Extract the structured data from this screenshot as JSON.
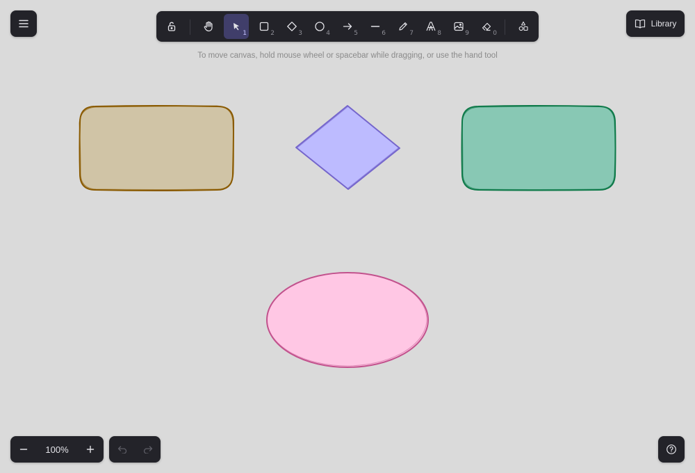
{
  "app": {
    "hint": "To move canvas, hold mouse wheel or spacebar while dragging, or use the hand tool",
    "library_label": "Library",
    "zoom_level": "100%"
  },
  "toolbar": {
    "tools": [
      {
        "name": "lock",
        "icon": "lock-icon",
        "key": ""
      },
      {
        "name": "hand",
        "icon": "hand-icon",
        "key": ""
      },
      {
        "name": "selection",
        "icon": "pointer-icon",
        "key": "1",
        "selected": true
      },
      {
        "name": "rectangle",
        "icon": "square-icon",
        "key": "2"
      },
      {
        "name": "diamond",
        "icon": "diamond-icon",
        "key": "3"
      },
      {
        "name": "ellipse",
        "icon": "circle-icon",
        "key": "4"
      },
      {
        "name": "arrow",
        "icon": "arrow-right-icon",
        "key": "5"
      },
      {
        "name": "line",
        "icon": "line-icon",
        "key": "6"
      },
      {
        "name": "draw",
        "icon": "pencil-icon",
        "key": "7"
      },
      {
        "name": "text",
        "icon": "text-icon",
        "key": "8"
      },
      {
        "name": "image",
        "icon": "image-icon",
        "key": "9"
      },
      {
        "name": "eraser",
        "icon": "eraser-icon",
        "key": "0"
      },
      {
        "name": "more-tools",
        "icon": "shapes-icon",
        "key": ""
      }
    ]
  },
  "shapes": [
    {
      "type": "rectangle",
      "fill": "#d0c4a6",
      "stroke": "#8a5a00"
    },
    {
      "type": "diamond",
      "fill": "#bdbbff",
      "stroke": "#7566cc"
    },
    {
      "type": "rectangle",
      "fill": "#88c8b4",
      "stroke": "#0f7a4a"
    },
    {
      "type": "ellipse",
      "fill": "#ffc7e4",
      "stroke": "#c2528d"
    }
  ],
  "colors": {
    "canvas_bg": "#dadada",
    "panel_bg": "#232329",
    "selected_tool_bg": "#403e6a"
  }
}
